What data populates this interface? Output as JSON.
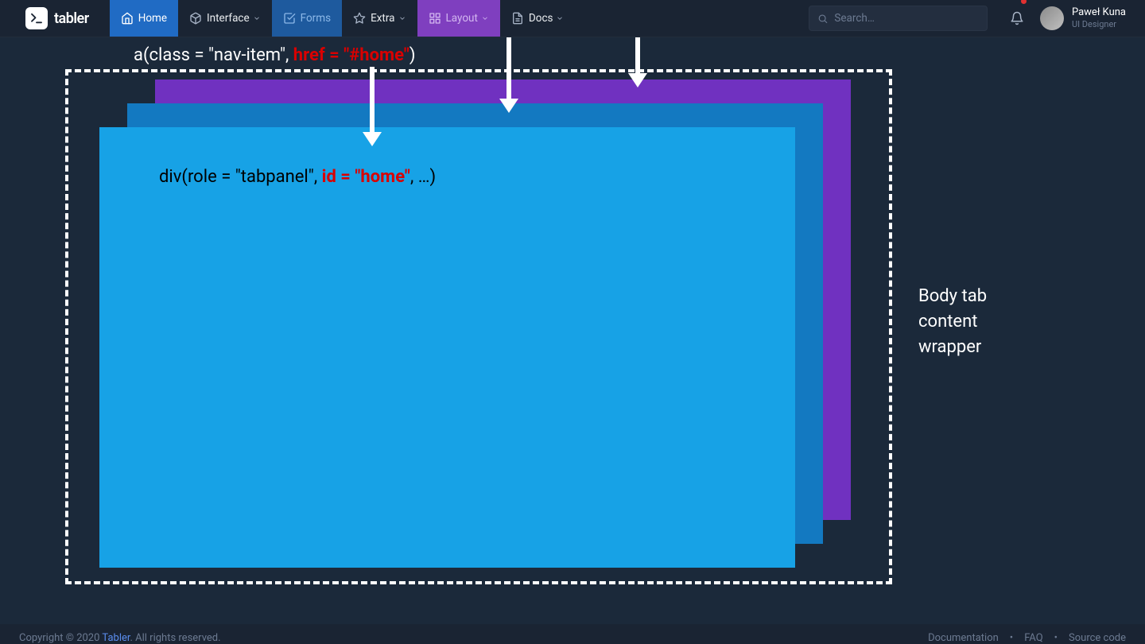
{
  "brand": {
    "name": "tabler"
  },
  "nav": {
    "home": "Home",
    "interface": "Interface",
    "forms": "Forms",
    "extra": "Extra",
    "layout": "Layout",
    "docs": "Docs"
  },
  "search": {
    "placeholder": "Search…"
  },
  "user": {
    "name": "Paweł Kuna",
    "role": "UI Designer"
  },
  "annotations": {
    "nav_code_prefix": "a(class = \"nav-item\", ",
    "nav_code_red": "href = \"#home\"",
    "nav_code_suffix": ")",
    "panel_code_prefix": "div(role = \"tabpanel\", ",
    "panel_code_red": "id = \"home\"",
    "panel_code_suffix": ", …)",
    "side_l1": "Body tab",
    "side_l2": "content",
    "side_l3": "wrapper"
  },
  "footer": {
    "copyright_pre": "Copyright © 2020 ",
    "copyright_link": "Tabler",
    "copyright_post": ". All rights reserved.",
    "links": {
      "docs": "Documentation",
      "faq": "FAQ",
      "source": "Source code"
    }
  }
}
